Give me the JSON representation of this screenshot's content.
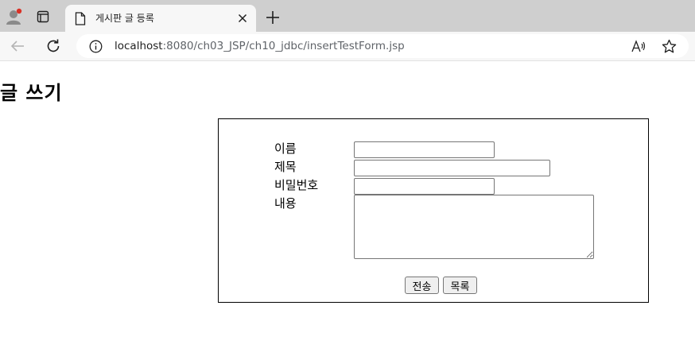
{
  "browser": {
    "tab_title": "게시판 글 등록",
    "url_host": "localhost",
    "url_path": ":8080/ch03_JSP/ch10_jdbc/insertTestForm.jsp"
  },
  "page": {
    "title": "글 쓰기",
    "form": {
      "name_label": "이름",
      "subject_label": "제목",
      "password_label": "비밀번호",
      "content_label": "내용",
      "name_value": "",
      "subject_value": "",
      "password_value": "",
      "content_value": "",
      "submit_label": "전송",
      "list_label": "목록"
    }
  },
  "colors": {
    "tabbar_bg": "#cfcfcf",
    "toolbar_bg": "#f7f7f7",
    "profile_badge": "#d93025"
  }
}
